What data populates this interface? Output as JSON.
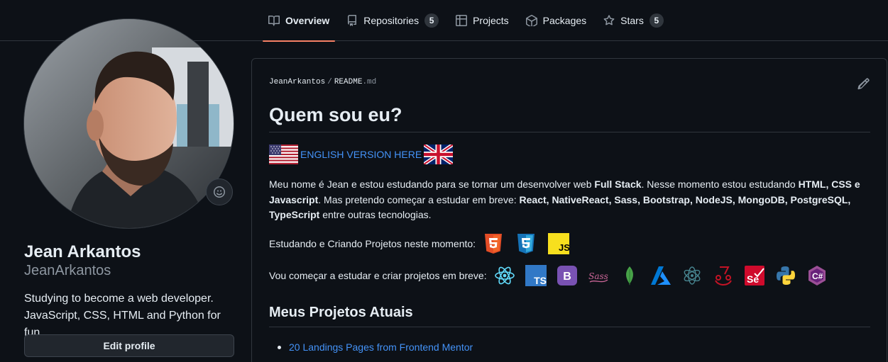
{
  "nav": {
    "tabs": [
      {
        "label": "Overview",
        "icon": "book-icon"
      },
      {
        "label": "Repositories",
        "icon": "repo-icon",
        "count": "5"
      },
      {
        "label": "Projects",
        "icon": "table-icon"
      },
      {
        "label": "Packages",
        "icon": "package-icon"
      },
      {
        "label": "Stars",
        "icon": "star-icon",
        "count": "5"
      }
    ],
    "active_tab": "Overview"
  },
  "profile": {
    "name": "Jean Arkantos",
    "login": "JeanArkantos",
    "bio": "Studying to become a web developer. JavaScript, CSS, HTML and Python for fun",
    "edit_button": "Edit profile"
  },
  "readme": {
    "breadcrumb_user": "JeanArkantos",
    "breadcrumb_sep": "/",
    "breadcrumb_file": "README",
    "breadcrumb_ext": ".md",
    "heading": "Quem sou eu?",
    "english_link": "ENGLISH VERSION HERE",
    "intro": {
      "t1": "Meu nome é Jean e estou estudando para se tornar um desenvolver web ",
      "b1": "Full Stack",
      "t2": ". Nesse momento estou estudando ",
      "b2": "HTML, CSS e Javascript",
      "t3": ". Mas pretendo começar a estudar em breve: ",
      "b3": "React, NativeReact, Sass, Bootstrap, NodeJS, MongoDB, PostgreSQL, TypeScript",
      "t4": " entre outras tecnologias."
    },
    "studying_label": "Estudando e Criando Projetos neste momento:",
    "studying_icons": [
      "html5-icon",
      "css3-icon",
      "javascript-icon"
    ],
    "future_label": "Vou começar a estudar e criar projetos em breve:",
    "future_icons": [
      "react-icon",
      "typescript-icon",
      "bootstrap-icon",
      "sass-icon",
      "mongodb-icon",
      "azure-icon",
      "electron-icon",
      "jest-icon",
      "selenium-icon",
      "python-icon",
      "csharp-icon"
    ],
    "projects_heading": "Meus Projetos Atuais",
    "projects": [
      "20 Landings Pages from Frontend Mentor"
    ]
  },
  "colors": {
    "background": "#0d1117",
    "border": "#30363d",
    "link": "#4493f8",
    "active_tab_underline": "#f78166"
  }
}
